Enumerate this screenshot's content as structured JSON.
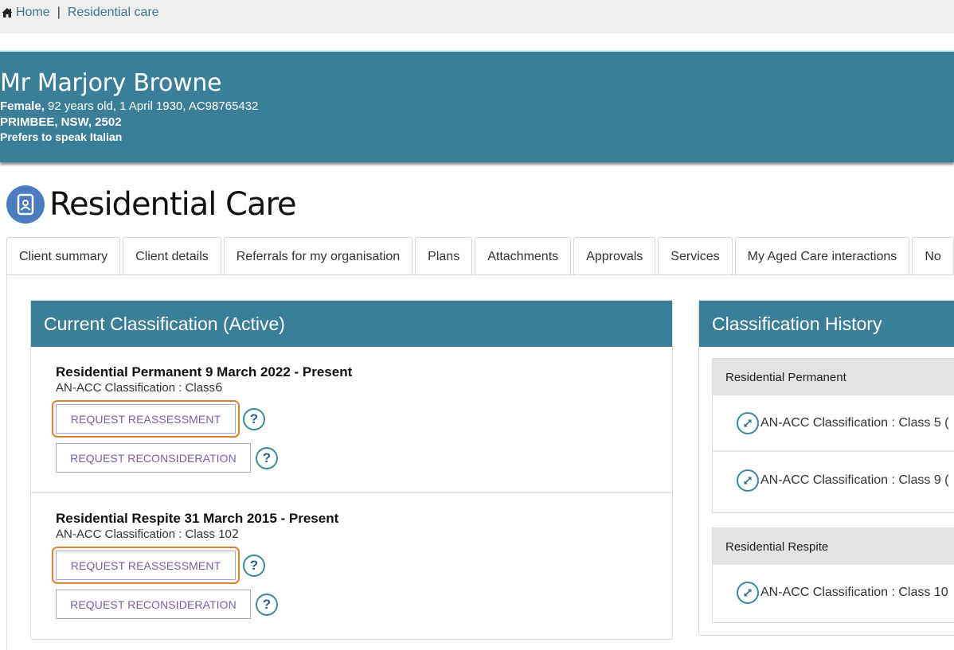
{
  "breadcrumb": {
    "home_icon": "home-icon",
    "home_label": "Home",
    "separator": "|",
    "current_label": "Residential care"
  },
  "client": {
    "name": "Mr Marjory Browne",
    "gender": "Female,",
    "details": " 92 years old, 1 April 1930, AC98765432",
    "address": "PRIMBEE, NSW, 2502",
    "language": "Prefers to speak Italian"
  },
  "page": {
    "icon": "client-document-icon",
    "title": "Residential Care"
  },
  "tabs": [
    {
      "label": "Client summary"
    },
    {
      "label": "Client details"
    },
    {
      "label": "Referrals for my organisation"
    },
    {
      "label": "Plans"
    },
    {
      "label": "Attachments"
    },
    {
      "label": "Approvals"
    },
    {
      "label": "Services"
    },
    {
      "label": "My Aged Care interactions"
    },
    {
      "label": "No"
    }
  ],
  "current_classification": {
    "title": "Current Classification (Active)",
    "blocks": [
      {
        "title": "Residential Permanent 9 March 2022 - Present",
        "subtitle_prefix": "AN-ACC Classification : Class",
        "class_number": "6",
        "reassess_label": "REQUEST REASSESSMENT",
        "reconsider_label": "REQUEST RECONSIDERATION",
        "help_icon": "?"
      },
      {
        "title": "Residential Respite 31 March 2015 - Present",
        "subtitle_prefix": "AN-ACC Classification : Class 10",
        "class_number": "2",
        "reassess_label": "REQUEST REASSESSMENT",
        "reconsider_label": "REQUEST RECONSIDERATION",
        "help_icon": "?"
      }
    ]
  },
  "classification_history": {
    "title": "Classification History",
    "groups": [
      {
        "label": "Residential Permanent",
        "items": [
          {
            "text": "AN-ACC Classification : Class 5 ("
          },
          {
            "text": "AN-ACC Classification : Class 9 ("
          }
        ]
      },
      {
        "label": "Residential Respite",
        "items": [
          {
            "text": "AN-ACC Classification : Class 10"
          }
        ]
      }
    ]
  },
  "colors": {
    "banner": "#3a7f97",
    "highlight": "#e1802f",
    "button_text": "#7a5ea3",
    "button_border": "#b8a4d2",
    "title_icon": "#4a7cbf"
  }
}
